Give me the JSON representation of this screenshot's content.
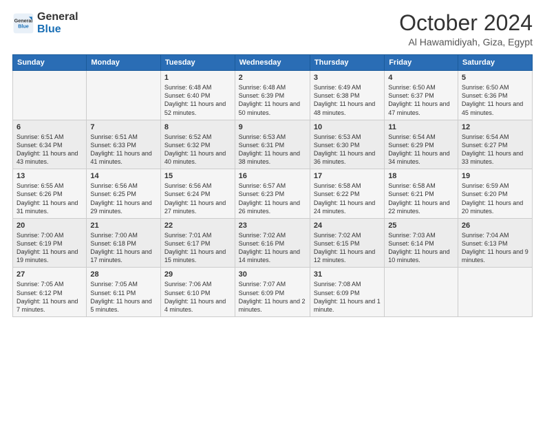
{
  "logo": {
    "text_general": "General",
    "text_blue": "Blue"
  },
  "header": {
    "month": "October 2024",
    "location": "Al Hawamidiyah, Giza, Egypt"
  },
  "weekdays": [
    "Sunday",
    "Monday",
    "Tuesday",
    "Wednesday",
    "Thursday",
    "Friday",
    "Saturday"
  ],
  "weeks": [
    [
      {
        "day": "",
        "info": ""
      },
      {
        "day": "",
        "info": ""
      },
      {
        "day": "1",
        "info": "Sunrise: 6:48 AM\nSunset: 6:40 PM\nDaylight: 11 hours and 52 minutes."
      },
      {
        "day": "2",
        "info": "Sunrise: 6:48 AM\nSunset: 6:39 PM\nDaylight: 11 hours and 50 minutes."
      },
      {
        "day": "3",
        "info": "Sunrise: 6:49 AM\nSunset: 6:38 PM\nDaylight: 11 hours and 48 minutes."
      },
      {
        "day": "4",
        "info": "Sunrise: 6:50 AM\nSunset: 6:37 PM\nDaylight: 11 hours and 47 minutes."
      },
      {
        "day": "5",
        "info": "Sunrise: 6:50 AM\nSunset: 6:36 PM\nDaylight: 11 hours and 45 minutes."
      }
    ],
    [
      {
        "day": "6",
        "info": "Sunrise: 6:51 AM\nSunset: 6:34 PM\nDaylight: 11 hours and 43 minutes."
      },
      {
        "day": "7",
        "info": "Sunrise: 6:51 AM\nSunset: 6:33 PM\nDaylight: 11 hours and 41 minutes."
      },
      {
        "day": "8",
        "info": "Sunrise: 6:52 AM\nSunset: 6:32 PM\nDaylight: 11 hours and 40 minutes."
      },
      {
        "day": "9",
        "info": "Sunrise: 6:53 AM\nSunset: 6:31 PM\nDaylight: 11 hours and 38 minutes."
      },
      {
        "day": "10",
        "info": "Sunrise: 6:53 AM\nSunset: 6:30 PM\nDaylight: 11 hours and 36 minutes."
      },
      {
        "day": "11",
        "info": "Sunrise: 6:54 AM\nSunset: 6:29 PM\nDaylight: 11 hours and 34 minutes."
      },
      {
        "day": "12",
        "info": "Sunrise: 6:54 AM\nSunset: 6:27 PM\nDaylight: 11 hours and 33 minutes."
      }
    ],
    [
      {
        "day": "13",
        "info": "Sunrise: 6:55 AM\nSunset: 6:26 PM\nDaylight: 11 hours and 31 minutes."
      },
      {
        "day": "14",
        "info": "Sunrise: 6:56 AM\nSunset: 6:25 PM\nDaylight: 11 hours and 29 minutes."
      },
      {
        "day": "15",
        "info": "Sunrise: 6:56 AM\nSunset: 6:24 PM\nDaylight: 11 hours and 27 minutes."
      },
      {
        "day": "16",
        "info": "Sunrise: 6:57 AM\nSunset: 6:23 PM\nDaylight: 11 hours and 26 minutes."
      },
      {
        "day": "17",
        "info": "Sunrise: 6:58 AM\nSunset: 6:22 PM\nDaylight: 11 hours and 24 minutes."
      },
      {
        "day": "18",
        "info": "Sunrise: 6:58 AM\nSunset: 6:21 PM\nDaylight: 11 hours and 22 minutes."
      },
      {
        "day": "19",
        "info": "Sunrise: 6:59 AM\nSunset: 6:20 PM\nDaylight: 11 hours and 20 minutes."
      }
    ],
    [
      {
        "day": "20",
        "info": "Sunrise: 7:00 AM\nSunset: 6:19 PM\nDaylight: 11 hours and 19 minutes."
      },
      {
        "day": "21",
        "info": "Sunrise: 7:00 AM\nSunset: 6:18 PM\nDaylight: 11 hours and 17 minutes."
      },
      {
        "day": "22",
        "info": "Sunrise: 7:01 AM\nSunset: 6:17 PM\nDaylight: 11 hours and 15 minutes."
      },
      {
        "day": "23",
        "info": "Sunrise: 7:02 AM\nSunset: 6:16 PM\nDaylight: 11 hours and 14 minutes."
      },
      {
        "day": "24",
        "info": "Sunrise: 7:02 AM\nSunset: 6:15 PM\nDaylight: 11 hours and 12 minutes."
      },
      {
        "day": "25",
        "info": "Sunrise: 7:03 AM\nSunset: 6:14 PM\nDaylight: 11 hours and 10 minutes."
      },
      {
        "day": "26",
        "info": "Sunrise: 7:04 AM\nSunset: 6:13 PM\nDaylight: 11 hours and 9 minutes."
      }
    ],
    [
      {
        "day": "27",
        "info": "Sunrise: 7:05 AM\nSunset: 6:12 PM\nDaylight: 11 hours and 7 minutes."
      },
      {
        "day": "28",
        "info": "Sunrise: 7:05 AM\nSunset: 6:11 PM\nDaylight: 11 hours and 5 minutes."
      },
      {
        "day": "29",
        "info": "Sunrise: 7:06 AM\nSunset: 6:10 PM\nDaylight: 11 hours and 4 minutes."
      },
      {
        "day": "30",
        "info": "Sunrise: 7:07 AM\nSunset: 6:09 PM\nDaylight: 11 hours and 2 minutes."
      },
      {
        "day": "31",
        "info": "Sunrise: 7:08 AM\nSunset: 6:09 PM\nDaylight: 11 hours and 1 minute."
      },
      {
        "day": "",
        "info": ""
      },
      {
        "day": "",
        "info": ""
      }
    ]
  ]
}
